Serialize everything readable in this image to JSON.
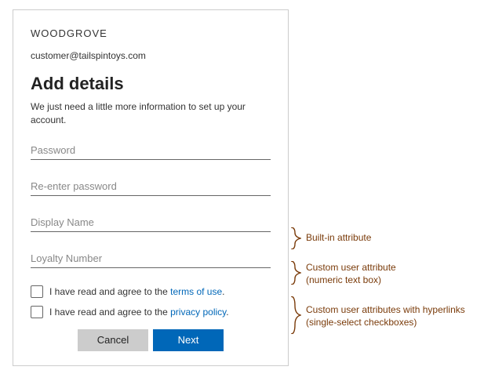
{
  "card": {
    "brand": "WOODGROVE",
    "email": "customer@tailspintoys.com",
    "title": "Add details",
    "subtitle": "We just need a little more information to set up your account.",
    "fields": {
      "password_placeholder": "Password",
      "reenter_placeholder": "Re-enter password",
      "displayname_placeholder": "Display Name",
      "loyalty_placeholder": "Loyalty Number"
    },
    "consents": {
      "terms_prefix": "I have read and agree to the ",
      "terms_link": "terms of use",
      "terms_suffix": ".",
      "privacy_prefix": "I have read and agree to the ",
      "privacy_link": "privacy policy",
      "privacy_suffix": "."
    },
    "buttons": {
      "cancel": "Cancel",
      "next": "Next"
    }
  },
  "annotations": {
    "builtin": "Built-in attribute",
    "custom_numeric_l1": "Custom user attribute",
    "custom_numeric_l2": "(numeric text box)",
    "custom_checks_l1": "Custom user attributes with hyperlinks",
    "custom_checks_l2": "(single-select checkboxes)"
  }
}
